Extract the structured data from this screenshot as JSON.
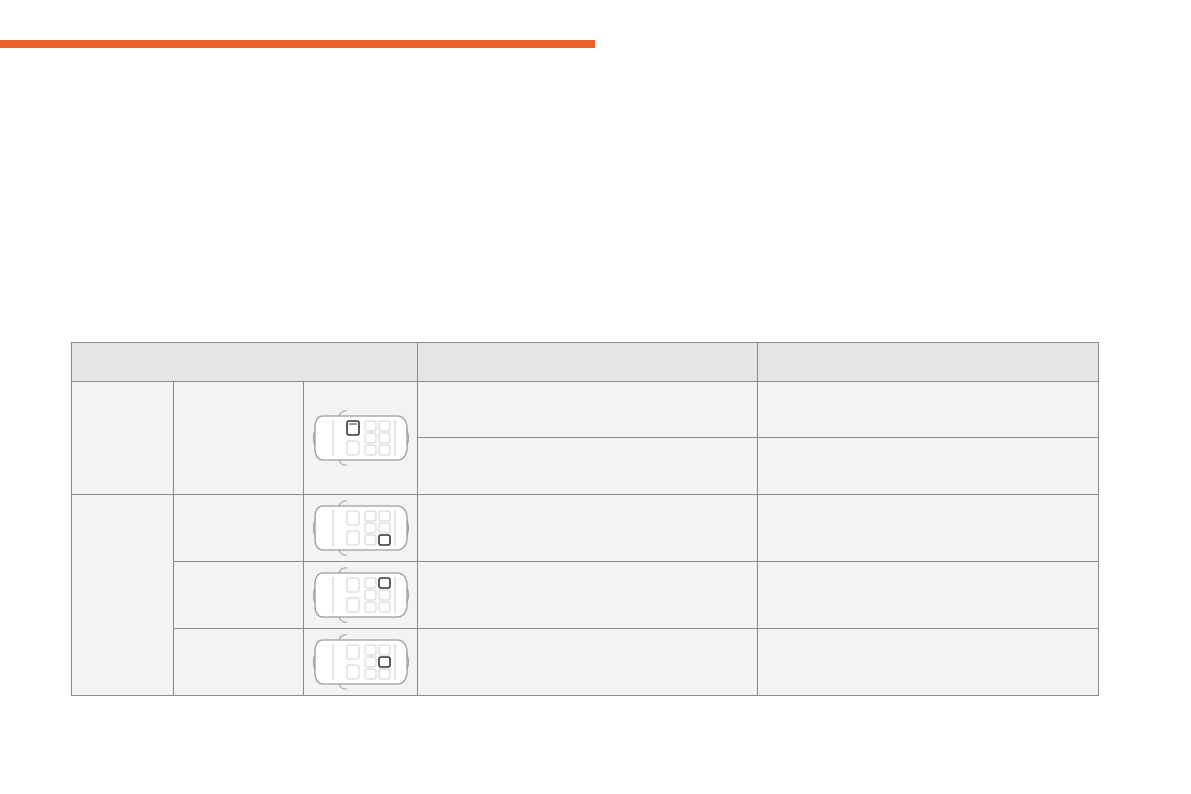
{
  "theme": {
    "accent": "#e8622a"
  },
  "table": {
    "header": {
      "col1": "",
      "col2": "",
      "col3": ""
    },
    "rows": [
      {
        "group": "",
        "position": "",
        "icon": "car-top-view-front-seat-icon",
        "options": [
          "",
          ""
        ],
        "notes": [
          "",
          ""
        ]
      },
      {
        "group": "",
        "position": "",
        "icon": "car-top-view-rear-right-seat-icon",
        "option": "",
        "note": ""
      },
      {
        "position": "",
        "icon": "car-top-view-rear-center-seat-icon",
        "option": "",
        "note": ""
      },
      {
        "position": "",
        "icon": "car-top-view-rear-left-seat-icon",
        "option": "",
        "note": ""
      }
    ]
  }
}
